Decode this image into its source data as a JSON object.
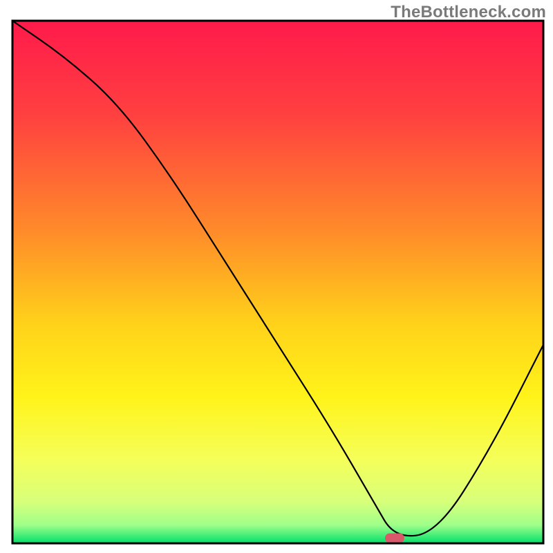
{
  "watermark": "TheBottleneck.com",
  "chart_data": {
    "type": "line",
    "title": "",
    "xlabel": "",
    "ylabel": "",
    "xlim": [
      0,
      100
    ],
    "ylim": [
      0,
      100
    ],
    "x": [
      0,
      10,
      20,
      30,
      40,
      50,
      60,
      68,
      72,
      80,
      90,
      100
    ],
    "values": [
      100,
      93,
      84,
      70,
      54,
      38,
      22,
      8,
      1,
      2,
      18,
      38
    ],
    "optimal_point": {
      "x": 72,
      "y": 1
    },
    "gradient_stops": [
      {
        "offset": 0.0,
        "color": "#ff1a4b"
      },
      {
        "offset": 0.18,
        "color": "#ff4040"
      },
      {
        "offset": 0.4,
        "color": "#ff8a2a"
      },
      {
        "offset": 0.58,
        "color": "#ffd21a"
      },
      {
        "offset": 0.72,
        "color": "#fff31a"
      },
      {
        "offset": 0.84,
        "color": "#f5ff5a"
      },
      {
        "offset": 0.92,
        "color": "#d8ff7a"
      },
      {
        "offset": 0.965,
        "color": "#9fff8a"
      },
      {
        "offset": 1.0,
        "color": "#00e06a"
      }
    ],
    "marker": {
      "fill": "#d9596a",
      "rx": 14,
      "ry": 7
    },
    "frame_color": "#000000",
    "curve_color": "#000000"
  }
}
